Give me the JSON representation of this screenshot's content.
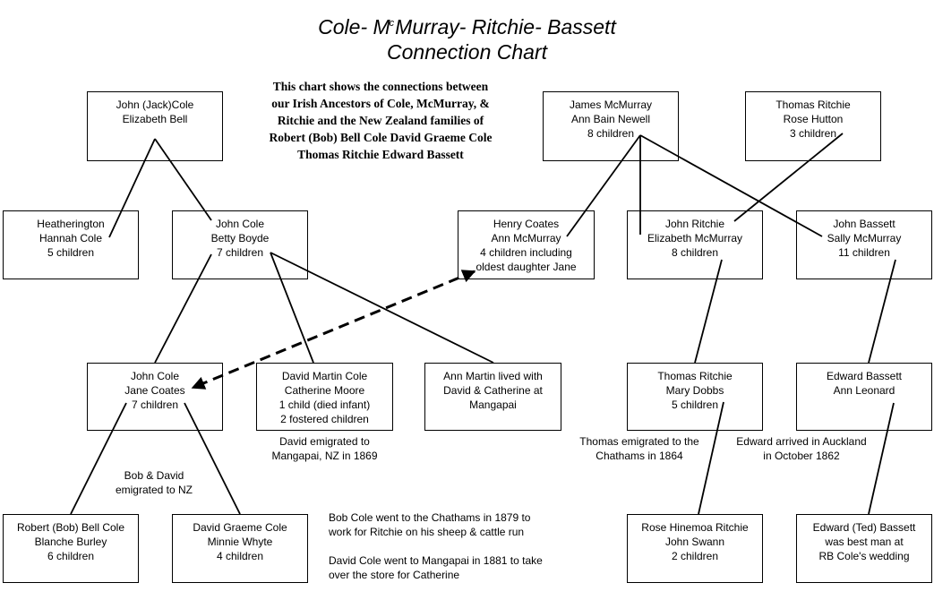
{
  "title": {
    "part1": "Cole- M",
    "superscript": "c",
    "part2": "Murray- Ritchie- Bassett",
    "line2": "Connection Chart"
  },
  "intro": {
    "lines": [
      "This chart shows the connections",
      "between our Irish Ancestors of",
      "Cole, McMurray, & Ritchie and",
      "the New Zealand families  of",
      "Robert (Bob) Bell Cole",
      "David Graeme Cole",
      "Thomas Ritchie",
      "Edward  Bassett"
    ]
  },
  "boxes": {
    "jack_cole": {
      "lines": [
        "John (Jack)Cole",
        "Elizabeth Bell"
      ]
    },
    "james_mcmurray": {
      "lines": [
        "James McMurray",
        "Ann Bain Newell",
        "8 children"
      ]
    },
    "thomas_ritchie_sr": {
      "lines": [
        "Thomas Ritchie",
        "Rose Hutton",
        "3 children"
      ]
    },
    "heatherington": {
      "lines": [
        "Heatherington",
        "Hannah Cole",
        "5 children"
      ]
    },
    "john_cole_betty": {
      "lines": [
        "John Cole",
        "Betty Boyde",
        "7 children"
      ]
    },
    "henry_coates": {
      "lines": [
        "Henry Coates",
        "Ann McMurray",
        "4 children including",
        "oldest daughter Jane"
      ]
    },
    "john_ritchie": {
      "lines": [
        "John Ritchie",
        "Elizabeth McMurray",
        "8 children"
      ]
    },
    "john_bassett": {
      "lines": [
        "John Bassett",
        "Sally McMurray",
        "11 children"
      ]
    },
    "john_cole_jane": {
      "lines": [
        "John Cole",
        "Jane Coates",
        "7 children"
      ]
    },
    "david_martin_cole": {
      "lines": [
        "David Martin Cole",
        "Catherine Moore",
        "1 child (died infant)",
        "2 fostered children"
      ]
    },
    "ann_martin": {
      "lines": [
        "Ann Martin lived with",
        "David & Catherine at",
        "Mangapai"
      ]
    },
    "thomas_ritchie_jr": {
      "lines": [
        "Thomas Ritchie",
        "Mary Dobbs",
        "5 children"
      ]
    },
    "edward_bassett": {
      "lines": [
        "Edward Bassett",
        "Ann Leonard"
      ]
    },
    "robert_bell_cole": {
      "lines": [
        "Robert (Bob) Bell Cole",
        "Blanche Burley",
        "6 children"
      ]
    },
    "david_graeme_cole": {
      "lines": [
        "David Graeme Cole",
        "Minnie Whyte",
        "4 children"
      ]
    },
    "rose_ritchie": {
      "lines": [
        "Rose Hinemoa Ritchie",
        "John Swann",
        "2 children"
      ]
    },
    "ted_bassett": {
      "lines": [
        "Edward (Ted) Bassett",
        "was best man at",
        "RB Cole's wedding"
      ]
    }
  },
  "notes": {
    "david_emigrated": {
      "lines": [
        "David emigrated to",
        "Mangapai, NZ in 1869"
      ]
    },
    "thomas_emigrated": {
      "lines": [
        "Thomas emigrated to the",
        "Chathams in 1864"
      ]
    },
    "edward_arrived": {
      "lines": [
        "Edward arrived in Auckland",
        "in October 1862"
      ]
    },
    "bob_david_emigrated": {
      "lines": [
        "Bob & David",
        "emigrated to NZ"
      ]
    },
    "bob_chathams": {
      "lines": [
        "Bob Cole went to the Chathams in 1879 to",
        "work for Ritchie on his sheep & cattle run"
      ]
    },
    "david_mangapai": {
      "lines": [
        "David Cole went to Mangapai in 1881 to take",
        "over the store for Catherine"
      ]
    }
  },
  "connections": [
    {
      "from": "jack_cole",
      "to": "heatherington",
      "style": "solid"
    },
    {
      "from": "jack_cole",
      "to": "john_cole_betty",
      "style": "solid"
    },
    {
      "from": "james_mcmurray",
      "to": "henry_coates",
      "style": "solid"
    },
    {
      "from": "james_mcmurray",
      "to": "john_ritchie",
      "style": "solid"
    },
    {
      "from": "james_mcmurray",
      "to": "john_bassett",
      "style": "solid"
    },
    {
      "from": "thomas_ritchie_sr",
      "to": "john_ritchie",
      "style": "solid"
    },
    {
      "from": "john_cole_betty",
      "to": "john_cole_jane",
      "style": "solid"
    },
    {
      "from": "john_cole_betty",
      "to": "david_martin_cole",
      "style": "solid"
    },
    {
      "from": "john_cole_betty",
      "to": "ann_martin",
      "style": "solid"
    },
    {
      "from": "john_ritchie",
      "to": "thomas_ritchie_jr",
      "style": "solid"
    },
    {
      "from": "john_bassett",
      "to": "edward_bassett",
      "style": "solid"
    },
    {
      "from": "john_cole_jane",
      "to": "robert_bell_cole",
      "style": "solid"
    },
    {
      "from": "john_cole_jane",
      "to": "david_graeme_cole",
      "style": "solid"
    },
    {
      "from": "thomas_ritchie_jr",
      "to": "rose_ritchie",
      "style": "solid"
    },
    {
      "from": "edward_bassett",
      "to": "ted_bassett",
      "style": "solid"
    },
    {
      "from": "henry_coates",
      "to": "john_cole_jane",
      "style": "dashed-double-arrow"
    }
  ]
}
